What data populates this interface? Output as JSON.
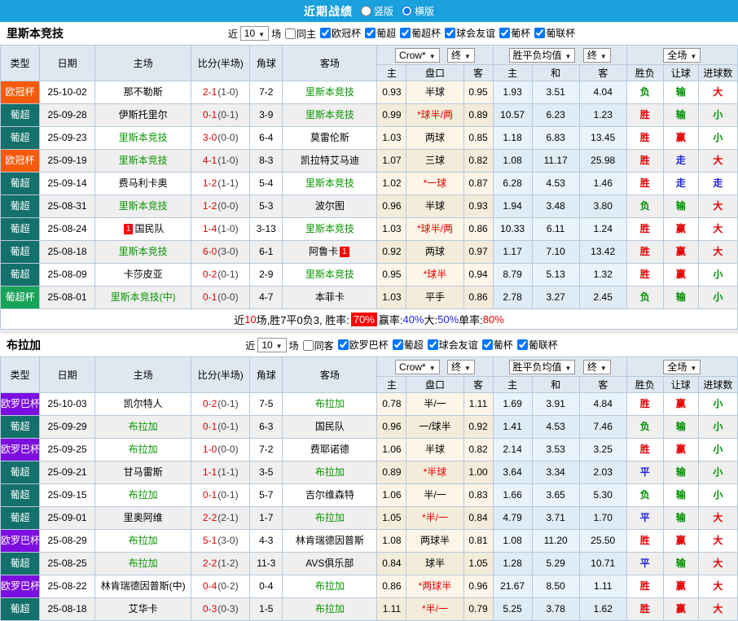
{
  "topbar": {
    "title": "近期战绩",
    "options": [
      {
        "label": "竖版",
        "checked": false
      },
      {
        "label": "横版",
        "checked": true
      }
    ]
  },
  "colors": {
    "topbar_bg": "#1aa0dc",
    "ucl_badge": "#f75b09",
    "pt_badge": "#13706b",
    "ptc_badge": "#16a258",
    "uel_badge": "#7c0fe0",
    "win": "#e60000",
    "draw": "#2222dd",
    "lose": "#009000"
  },
  "table_header": {
    "cols": [
      "类型",
      "日期",
      "主场",
      "比分(半场)",
      "角球",
      "客场"
    ],
    "odds_source": "Crow*",
    "final1": "终",
    "mean_label": "胜平负均值",
    "final2": "终",
    "scope": "全场",
    "sub": [
      "主",
      "盘口",
      "客",
      "主",
      "和",
      "客",
      "胜负",
      "让球",
      "进球数"
    ]
  },
  "sections": [
    {
      "team": "里斯本竞技",
      "filters": {
        "near": "近",
        "count": "10",
        "unit": "场",
        "same": "同主",
        "leagues": [
          "欧冠杯",
          "葡超",
          "葡超杯",
          "球会友谊",
          "葡杯",
          "葡联杯"
        ]
      },
      "rows": [
        {
          "lg": "欧冠杯",
          "lc": "ucl",
          "date": "25-10-02",
          "home": "那不勒斯",
          "hg": false,
          "hb": "",
          "ft": "2-1",
          "ht": "(1-0)",
          "cn": "7-2",
          "away": "里斯本竞技",
          "ag": true,
          "ab": "",
          "o1": "0.93",
          "line": "半球",
          "lr": false,
          "o2": "0.95",
          "w": "1.93",
          "d": "3.51",
          "l": "4.04",
          "res": [
            [
              "负",
              "g"
            ],
            [
              "输",
              "g"
            ],
            [
              "大",
              "r"
            ]
          ]
        },
        {
          "lg": "葡超",
          "lc": "pt",
          "date": "25-09-28",
          "home": "伊斯托里尔",
          "hg": false,
          "hb": "",
          "ft": "0-1",
          "ht": "(0-1)",
          "cn": "3-9",
          "away": "里斯本竞技",
          "ag": true,
          "ab": "",
          "o1": "0.99",
          "line": "*球半/两",
          "lr": true,
          "o2": "0.89",
          "w": "10.57",
          "d": "6.23",
          "l": "1.23",
          "res": [
            [
              "胜",
              "r"
            ],
            [
              "输",
              "g"
            ],
            [
              "小",
              "g"
            ]
          ]
        },
        {
          "lg": "葡超",
          "lc": "pt",
          "date": "25-09-23",
          "home": "里斯本竞技",
          "hg": true,
          "hb": "",
          "ft": "3-0",
          "ht": "(0-0)",
          "cn": "6-4",
          "away": "莫雷伦斯",
          "ag": false,
          "ab": "",
          "o1": "1.03",
          "line": "两球",
          "lr": false,
          "o2": "0.85",
          "w": "1.18",
          "d": "6.83",
          "l": "13.45",
          "res": [
            [
              "胜",
              "r"
            ],
            [
              "赢",
              "r"
            ],
            [
              "小",
              "g"
            ]
          ]
        },
        {
          "lg": "欧冠杯",
          "lc": "ucl",
          "date": "25-09-19",
          "home": "里斯本竞技",
          "hg": true,
          "hb": "",
          "ft": "4-1",
          "ht": "(1-0)",
          "cn": "8-3",
          "away": "凯拉特艾马迪",
          "ag": false,
          "ab": "",
          "o1": "1.07",
          "line": "三球",
          "lr": false,
          "o2": "0.82",
          "w": "1.08",
          "d": "11.17",
          "l": "25.98",
          "res": [
            [
              "胜",
              "r"
            ],
            [
              "走",
              "b"
            ],
            [
              "大",
              "r"
            ]
          ]
        },
        {
          "lg": "葡超",
          "lc": "pt",
          "date": "25-09-14",
          "home": "费马利卡奥",
          "hg": false,
          "hb": "",
          "ft": "1-2",
          "ht": "(1-1)",
          "cn": "5-4",
          "away": "里斯本竞技",
          "ag": true,
          "ab": "",
          "o1": "1.02",
          "line": "*一球",
          "lr": true,
          "o2": "0.87",
          "w": "6.28",
          "d": "4.53",
          "l": "1.46",
          "res": [
            [
              "胜",
              "r"
            ],
            [
              "走",
              "b"
            ],
            [
              "走",
              "b"
            ]
          ]
        },
        {
          "lg": "葡超",
          "lc": "pt",
          "date": "25-08-31",
          "home": "里斯本竞技",
          "hg": true,
          "hb": "",
          "ft": "1-2",
          "ht": "(0-0)",
          "cn": "5-3",
          "away": "波尔图",
          "ag": false,
          "ab": "",
          "o1": "0.96",
          "line": "半球",
          "lr": false,
          "o2": "0.93",
          "w": "1.94",
          "d": "3.48",
          "l": "3.80",
          "res": [
            [
              "负",
              "g"
            ],
            [
              "输",
              "g"
            ],
            [
              "大",
              "r"
            ]
          ]
        },
        {
          "lg": "葡超",
          "lc": "pt",
          "date": "25-08-24",
          "home": "国民队",
          "hg": false,
          "hb": "1",
          "ft": "1-4",
          "ht": "(1-0)",
          "cn": "3-13",
          "away": "里斯本竞技",
          "ag": true,
          "ab": "",
          "o1": "1.03",
          "line": "*球半/两",
          "lr": true,
          "o2": "0.86",
          "w": "10.33",
          "d": "6.11",
          "l": "1.24",
          "res": [
            [
              "胜",
              "r"
            ],
            [
              "赢",
              "r"
            ],
            [
              "大",
              "r"
            ]
          ]
        },
        {
          "lg": "葡超",
          "lc": "pt",
          "date": "25-08-18",
          "home": "里斯本竞技",
          "hg": true,
          "hb": "",
          "ft": "6-0",
          "ht": "(3-0)",
          "cn": "6-1",
          "away": "阿鲁卡",
          "ag": false,
          "ab": "1",
          "o1": "0.92",
          "line": "两球",
          "lr": false,
          "o2": "0.97",
          "w": "1.17",
          "d": "7.10",
          "l": "13.42",
          "res": [
            [
              "胜",
              "r"
            ],
            [
              "赢",
              "r"
            ],
            [
              "大",
              "r"
            ]
          ]
        },
        {
          "lg": "葡超",
          "lc": "pt",
          "date": "25-08-09",
          "home": "卡莎皮亚",
          "hg": false,
          "hb": "",
          "ft": "0-2",
          "ht": "(0-1)",
          "cn": "2-9",
          "away": "里斯本竞技",
          "ag": true,
          "ab": "",
          "o1": "0.95",
          "line": "*球半",
          "lr": true,
          "o2": "0.94",
          "w": "8.79",
          "d": "5.13",
          "l": "1.32",
          "res": [
            [
              "胜",
              "r"
            ],
            [
              "赢",
              "r"
            ],
            [
              "小",
              "g"
            ]
          ]
        },
        {
          "lg": "葡超杯",
          "lc": "ptc",
          "date": "25-08-01",
          "home": "里斯本竞技(中)",
          "hg": true,
          "hb": "",
          "ft": "0-1",
          "ht": "(0-0)",
          "cn": "4-7",
          "away": "本菲卡",
          "ag": false,
          "ab": "",
          "o1": "1.03",
          "line": "平手",
          "lr": false,
          "o2": "0.86",
          "w": "2.78",
          "d": "3.27",
          "l": "2.45",
          "res": [
            [
              "负",
              "g"
            ],
            [
              "输",
              "g"
            ],
            [
              "小",
              "g"
            ]
          ]
        }
      ],
      "summary": [
        [
          "近",
          "k"
        ],
        [
          "10",
          "r"
        ],
        [
          "场,胜7平0负3, 胜率: ",
          "k"
        ],
        [
          "70%",
          "hl"
        ],
        [
          " 赢率:",
          "k"
        ],
        [
          "40%",
          "b"
        ],
        [
          " 大:",
          "k"
        ],
        [
          "50%",
          "b"
        ],
        [
          " 单率:",
          "k"
        ],
        [
          "80%",
          "r"
        ]
      ]
    },
    {
      "team": "布拉加",
      "filters": {
        "near": "近",
        "count": "10",
        "unit": "场",
        "same": "同客",
        "leagues": [
          "欧罗巴杯",
          "葡超",
          "球会友谊",
          "葡杯",
          "葡联杯"
        ]
      },
      "rows": [
        {
          "lg": "欧罗巴杯",
          "lc": "uel",
          "date": "25-10-03",
          "home": "凯尔特人",
          "hg": false,
          "hb": "",
          "ft": "0-2",
          "ht": "(0-1)",
          "cn": "7-5",
          "away": "布拉加",
          "ag": true,
          "ab": "",
          "o1": "0.78",
          "line": "半/一",
          "lr": false,
          "o2": "1.11",
          "w": "1.69",
          "d": "3.91",
          "l": "4.84",
          "res": [
            [
              "胜",
              "r"
            ],
            [
              "赢",
              "r"
            ],
            [
              "小",
              "g"
            ]
          ]
        },
        {
          "lg": "葡超",
          "lc": "pt",
          "date": "25-09-29",
          "home": "布拉加",
          "hg": true,
          "hb": "",
          "ft": "0-1",
          "ht": "(0-1)",
          "cn": "6-3",
          "away": "国民队",
          "ag": false,
          "ab": "",
          "o1": "0.96",
          "line": "一/球半",
          "lr": false,
          "o2": "0.92",
          "w": "1.41",
          "d": "4.53",
          "l": "7.46",
          "res": [
            [
              "负",
              "g"
            ],
            [
              "输",
              "g"
            ],
            [
              "小",
              "g"
            ]
          ]
        },
        {
          "lg": "欧罗巴杯",
          "lc": "uel",
          "date": "25-09-25",
          "home": "布拉加",
          "hg": true,
          "hb": "",
          "ft": "1-0",
          "ht": "(0-0)",
          "cn": "7-2",
          "away": "费耶诺德",
          "ag": false,
          "ab": "",
          "o1": "1.06",
          "line": "半球",
          "lr": false,
          "o2": "0.82",
          "w": "2.14",
          "d": "3.53",
          "l": "3.25",
          "res": [
            [
              "胜",
              "r"
            ],
            [
              "赢",
              "r"
            ],
            [
              "小",
              "g"
            ]
          ]
        },
        {
          "lg": "葡超",
          "lc": "pt",
          "date": "25-09-21",
          "home": "甘马雷斯",
          "hg": false,
          "hb": "",
          "ft": "1-1",
          "ht": "(1-1)",
          "cn": "3-5",
          "away": "布拉加",
          "ag": true,
          "ab": "",
          "o1": "0.89",
          "line": "*半球",
          "lr": true,
          "o2": "1.00",
          "w": "3.64",
          "d": "3.34",
          "l": "2.03",
          "res": [
            [
              "平",
              "b"
            ],
            [
              "输",
              "g"
            ],
            [
              "小",
              "g"
            ]
          ]
        },
        {
          "lg": "葡超",
          "lc": "pt",
          "date": "25-09-15",
          "home": "布拉加",
          "hg": true,
          "hb": "",
          "ft": "0-1",
          "ht": "(0-1)",
          "cn": "5-7",
          "away": "吉尔维森特",
          "ag": false,
          "ab": "",
          "o1": "1.06",
          "line": "半/一",
          "lr": false,
          "o2": "0.83",
          "w": "1.66",
          "d": "3.65",
          "l": "5.30",
          "res": [
            [
              "负",
              "g"
            ],
            [
              "输",
              "g"
            ],
            [
              "小",
              "g"
            ]
          ]
        },
        {
          "lg": "葡超",
          "lc": "pt",
          "date": "25-09-01",
          "home": "里奥阿维",
          "hg": false,
          "hb": "",
          "ft": "2-2",
          "ht": "(2-1)",
          "cn": "1-7",
          "away": "布拉加",
          "ag": true,
          "ab": "",
          "o1": "1.05",
          "line": "*半/一",
          "lr": true,
          "o2": "0.84",
          "w": "4.79",
          "d": "3.71",
          "l": "1.70",
          "res": [
            [
              "平",
              "b"
            ],
            [
              "输",
              "g"
            ],
            [
              "大",
              "r"
            ]
          ]
        },
        {
          "lg": "欧罗巴杯",
          "lc": "uel",
          "date": "25-08-29",
          "home": "布拉加",
          "hg": true,
          "hb": "",
          "ft": "5-1",
          "ht": "(3-0)",
          "cn": "4-3",
          "away": "林肯瑞德因普斯",
          "ag": false,
          "ab": "",
          "o1": "1.08",
          "line": "两球半",
          "lr": false,
          "o2": "0.81",
          "w": "1.08",
          "d": "11.20",
          "l": "25.50",
          "res": [
            [
              "胜",
              "r"
            ],
            [
              "赢",
              "r"
            ],
            [
              "大",
              "r"
            ]
          ]
        },
        {
          "lg": "葡超",
          "lc": "pt",
          "date": "25-08-25",
          "home": "布拉加",
          "hg": true,
          "hb": "",
          "ft": "2-2",
          "ht": "(1-2)",
          "cn": "11-3",
          "away": "AVS俱乐部",
          "ag": false,
          "ab": "",
          "o1": "0.84",
          "line": "球半",
          "lr": false,
          "o2": "1.05",
          "w": "1.28",
          "d": "5.29",
          "l": "10.71",
          "res": [
            [
              "平",
              "b"
            ],
            [
              "输",
              "g"
            ],
            [
              "大",
              "r"
            ]
          ]
        },
        {
          "lg": "欧罗巴杯",
          "lc": "uel",
          "date": "25-08-22",
          "home": "林肯瑞德因普斯(中)",
          "hg": false,
          "hb": "",
          "ft": "0-4",
          "ht": "(0-2)",
          "cn": "0-4",
          "away": "布拉加",
          "ag": true,
          "ab": "",
          "o1": "0.86",
          "line": "*两球半",
          "lr": true,
          "o2": "0.96",
          "w": "21.67",
          "d": "8.50",
          "l": "1.11",
          "res": [
            [
              "胜",
              "r"
            ],
            [
              "赢",
              "r"
            ],
            [
              "大",
              "r"
            ]
          ]
        },
        {
          "lg": "葡超",
          "lc": "pt",
          "date": "25-08-18",
          "home": "艾华卡",
          "hg": false,
          "hb": "",
          "ft": "0-3",
          "ht": "(0-3)",
          "cn": "1-5",
          "away": "布拉加",
          "ag": true,
          "ab": "",
          "o1": "1.11",
          "line": "*半/一",
          "lr": true,
          "o2": "0.79",
          "w": "5.25",
          "d": "3.78",
          "l": "1.62",
          "res": [
            [
              "胜",
              "r"
            ],
            [
              "赢",
              "r"
            ],
            [
              "大",
              "r"
            ]
          ]
        }
      ],
      "summary": null
    }
  ]
}
